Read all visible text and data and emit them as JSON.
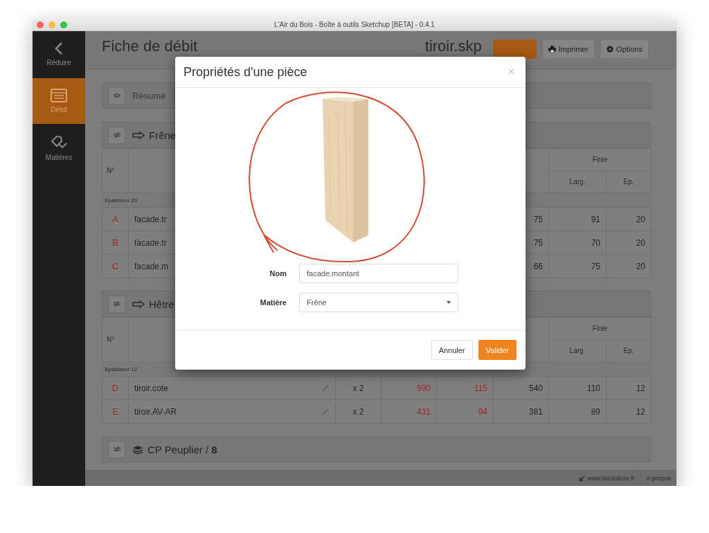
{
  "window": {
    "title": "L'Air du Bois - Boîte à outils Sketchup [BETA] - 0.4.1"
  },
  "sidebar": {
    "items": [
      {
        "label": "Réduire",
        "kind": "back",
        "selected": false
      },
      {
        "label": "Débit",
        "kind": "sheet",
        "selected": true
      },
      {
        "label": "Matières",
        "kind": "tag",
        "selected": false
      }
    ]
  },
  "header": {
    "title": "Fiche de débit",
    "file": "tiroir.skp",
    "buttons": [
      {
        "label": "Imprimer",
        "kind": "print"
      },
      {
        "label": "Options",
        "kind": "options"
      }
    ]
  },
  "summary": {
    "label": "Résumé"
  },
  "groups": [
    {
      "kind": "board",
      "name": "Frêne",
      "table": {
        "headings": {
          "no": "N°",
          "finished": "Finie",
          "larg": "Larg.",
          "ep": "Ep."
        },
        "sections": [
          {
            "label": "Epaisseur 20",
            "rows": [
              {
                "id": "A",
                "name": "facade.tr",
                "column_6": "75",
                "larg": "91",
                "ep": "20"
              },
              {
                "id": "B",
                "name": "facade.tr",
                "column_6": "75",
                "larg": "70",
                "ep": "20"
              },
              {
                "id": "C",
                "name": "facade.m",
                "column_6": "66",
                "larg": "75",
                "ep": "20"
              }
            ]
          }
        ]
      }
    },
    {
      "kind": "board",
      "name": "Hêtre",
      "table": {
        "headings": {
          "no": "N°",
          "finished": "Finie",
          "larg": "Larg.",
          "ep": "Ep."
        },
        "sections": [
          {
            "label": "Epaisseur 12",
            "rows": [
              {
                "id": "D",
                "name": "tiroir.cote",
                "edit_icon": true,
                "qty": "x 2",
                "column_4": "590",
                "column_5": "115",
                "column_6": "540",
                "larg": "110",
                "ep": "12"
              },
              {
                "id": "E",
                "name": "tiroir.AV-AR",
                "edit_icon": true,
                "qty": "x 2",
                "column_4": "431",
                "column_5": "94",
                "column_6": "381",
                "larg": "89",
                "ep": "12"
              }
            ]
          }
        ]
      }
    },
    {
      "kind": "sheet",
      "name": "CP Peuplier / **8**"
    }
  ],
  "status_bar": {
    "link": "www.lairdubois.fr",
    "about": "A propos"
  },
  "dialog": {
    "title": "Propriétés d'une pièce",
    "close": "×",
    "fields": [
      {
        "label": "Nom",
        "kind": "text",
        "value": "facade.montant"
      },
      {
        "label": "Matière",
        "kind": "select",
        "value": "Frêne"
      }
    ],
    "buttons": [
      {
        "label": "Annuler",
        "kind": "default"
      },
      {
        "label": "Valider",
        "kind": "primary"
      }
    ]
  }
}
